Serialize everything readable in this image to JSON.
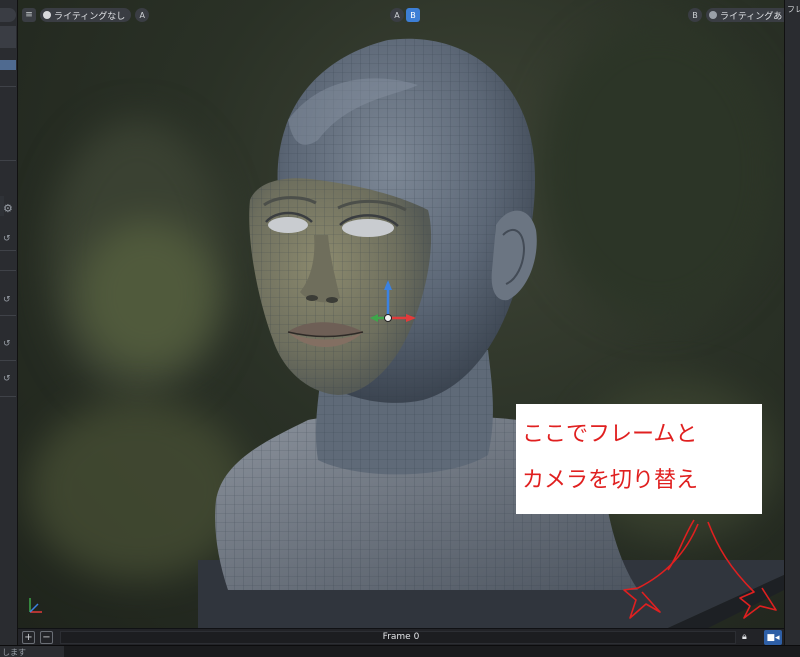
{
  "viewport_left": {
    "lighting_label": "ライティングなし",
    "camera_letter": "A"
  },
  "viewport_center": {
    "a_label": "A",
    "b_label": "B"
  },
  "viewport_right": {
    "camera_letter": "B",
    "lighting_label": "ライティングあり"
  },
  "annotation": {
    "line1": "ここでフレームと",
    "line2": "カメラを切り替え"
  },
  "bottom_bar": {
    "frame_label": "Frame 0",
    "add_label": "+",
    "remove_label": "−"
  },
  "right_panel": {
    "label": "フレ"
  },
  "status": {
    "text": "します"
  },
  "icons": {
    "menu": "hamburger-icon",
    "gizmo": "transform-gizmo-icon",
    "lock": "lock-icon",
    "camera": "camera-icon"
  },
  "colors": {
    "accent": "#3d7fd6",
    "annotation_text": "#e02020",
    "gizmo_x": "#e23b3b",
    "gizmo_y": "#3ea64a",
    "gizmo_z": "#3b82e2"
  }
}
